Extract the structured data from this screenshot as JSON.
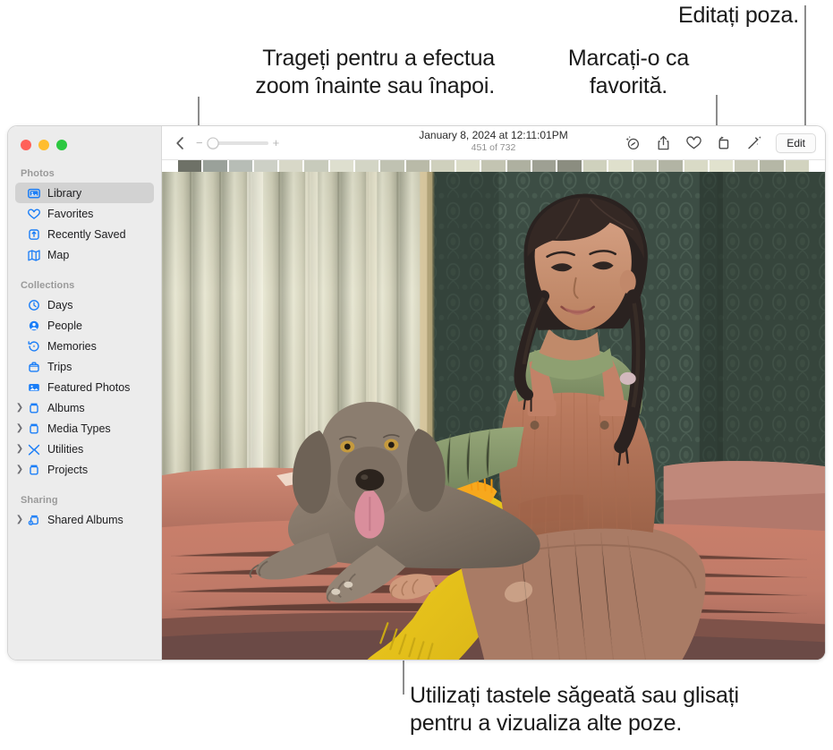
{
  "callouts": [
    {
      "id": "zoom",
      "text": "Trageți pentru a efectua\nzoom înainte sau înapoi."
    },
    {
      "id": "favorite",
      "text": "Marcați-o ca\nfavorită."
    },
    {
      "id": "edit",
      "text": "Editați poza."
    },
    {
      "id": "navigate",
      "text": "Utilizați tastele săgeată sau glisați\npentru a vizualiza alte poze."
    }
  ],
  "window": {
    "traffic_lights": [
      {
        "name": "close",
        "color": "#ff6159"
      },
      {
        "name": "minimize",
        "color": "#ffbd2e"
      },
      {
        "name": "zoom",
        "color": "#2bc840"
      }
    ]
  },
  "sidebar": {
    "sections": [
      {
        "title": "Photos",
        "items": [
          {
            "label": "Library",
            "icon": "library-icon",
            "selected": true,
            "disclosure": false
          },
          {
            "label": "Favorites",
            "icon": "heart-icon",
            "selected": false,
            "disclosure": false
          },
          {
            "label": "Recently Saved",
            "icon": "recently-saved-icon",
            "selected": false,
            "disclosure": false
          },
          {
            "label": "Map",
            "icon": "map-icon",
            "selected": false,
            "disclosure": false
          }
        ]
      },
      {
        "title": "Collections",
        "items": [
          {
            "label": "Days",
            "icon": "clock-icon",
            "selected": false,
            "disclosure": false
          },
          {
            "label": "People",
            "icon": "person-icon",
            "selected": false,
            "disclosure": false
          },
          {
            "label": "Memories",
            "icon": "memories-icon",
            "selected": false,
            "disclosure": false
          },
          {
            "label": "Trips",
            "icon": "suitcase-icon",
            "selected": false,
            "disclosure": false
          },
          {
            "label": "Featured Photos",
            "icon": "featured-photos-icon",
            "selected": false,
            "disclosure": false
          },
          {
            "label": "Albums",
            "icon": "album-icon",
            "selected": false,
            "disclosure": true
          },
          {
            "label": "Media Types",
            "icon": "album-icon",
            "selected": false,
            "disclosure": true
          },
          {
            "label": "Utilities",
            "icon": "utilities-icon",
            "selected": false,
            "disclosure": true
          },
          {
            "label": "Projects",
            "icon": "album-icon",
            "selected": false,
            "disclosure": true
          }
        ]
      },
      {
        "title": "Sharing",
        "items": [
          {
            "label": "Shared Albums",
            "icon": "shared-album-icon",
            "selected": false,
            "disclosure": true
          }
        ]
      }
    ]
  },
  "toolbar": {
    "back_icon": "chevron-left-icon",
    "zoom_minus": "−",
    "zoom_plus": "+",
    "zoom_value": 8,
    "title": "January 8, 2024 at 12:11:01PM",
    "subtitle": "451 of 732",
    "buttons": [
      {
        "name": "info-icon",
        "label": "Info"
      },
      {
        "name": "share-icon",
        "label": "Share"
      },
      {
        "name": "heart-icon",
        "label": "Favorite"
      },
      {
        "name": "rotate-icon",
        "label": "Rotate"
      },
      {
        "name": "enhance-icon",
        "label": "Auto Enhance"
      }
    ],
    "edit_label": "Edit"
  },
  "colors": {
    "accent": "#1b7ef7",
    "sidebar_bg": "#ececec",
    "selected_bg": "#d2d2d2",
    "text": "#1d1d1f",
    "muted": "#909090"
  },
  "photo": {
    "description": "Girl with braids petting a Weimaraner dog on a coral couch",
    "filmstrip_colors": [
      "#6e7167",
      "#9aa19a",
      "#b7bdb6",
      "#cdd0c6",
      "#d8d8c8",
      "#c8cbbc",
      "#dedfcf",
      "#d3d5c5",
      "#c0c2b2",
      "#b9baa8",
      "#cfd0bd",
      "#dcddc9",
      "#c3c4b2",
      "#aeb0a0",
      "#9ea093",
      "#8b8d80",
      "#cfd1bd",
      "#dfe0cc",
      "#c6c8b6",
      "#b2b4a4",
      "#d9dac6",
      "#e1e2ce",
      "#c9cab8",
      "#b5b7a6",
      "#d2d3bf"
    ]
  }
}
